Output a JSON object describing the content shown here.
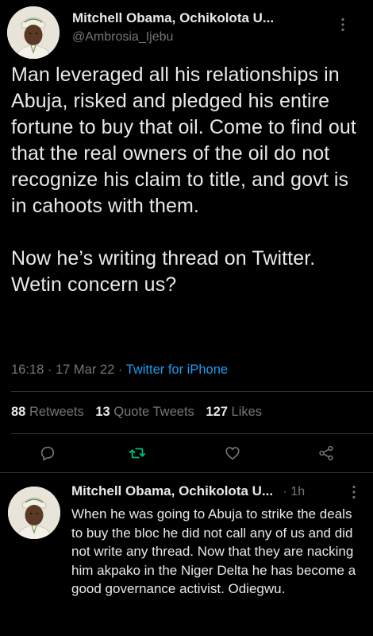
{
  "main_tweet": {
    "display_name": "Mitchell Obama, Ochikolota U...",
    "handle": "@Ambrosia_Ijebu",
    "paragraph1": "Man leveraged all his relationships in Abuja, risked and pledged his entire fortune to buy that oil. Come to find out that the real owners of the oil do not recognize his claim to title, and govt is in cahoots with them.",
    "paragraph2": "Now he’s writing thread on Twitter. Wetin concern us?",
    "time": "16:18",
    "date": "17 Mar 22",
    "separator": "·",
    "source": "Twitter for iPhone",
    "stats": {
      "retweets_count": "88",
      "retweets_label": "Retweets",
      "quotes_count": "13",
      "quotes_label": "Quote Tweets",
      "likes_count": "127",
      "likes_label": "Likes"
    },
    "actions": [
      "reply-icon",
      "retweet-icon",
      "like-icon",
      "share-icon"
    ]
  },
  "reply": {
    "display_name": "Mitchell Obama, Ochikolota U...",
    "time_ago": "· 1h",
    "text": "When he was going to Abuja to strike the deals to buy the bloc he did not call any of us and did not write any thread. Now that they are nacking him akpako in the Niger Delta he has become a good governance activist. Odiegwu."
  },
  "colors": {
    "background": "#000000",
    "text": "#e7e9ea",
    "secondary": "#71767b",
    "link": "#1d9bf0",
    "retweeted": "#00ba7c",
    "divider": "#2f3336"
  }
}
